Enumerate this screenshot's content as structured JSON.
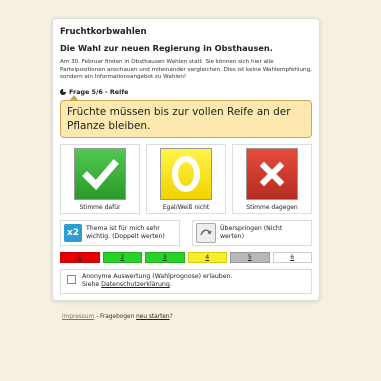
{
  "app_title": "Fruchtkorbwahlen",
  "headline": "Die Wahl zur neuen Regierung in Obsthausen.",
  "intro": "Am 30. Februar finden in Obsthausen Wahlen statt. Sie können sich hier alle Parteipositionen anschauen und miteinander vergleichen. Dies ist keine Wahlempfehlung, sondern ein Informationsangebot zu Wahlen!",
  "question": {
    "label": "Frage 5/6 - Reife",
    "text": "Früchte müssen bis zur vollen Reife an der Pflanze bleiben."
  },
  "answers": [
    {
      "label": "Stimme dafür",
      "icon": "check-icon",
      "color": "#3cb43c"
    },
    {
      "label": "Egal/Weiß nicht",
      "icon": "circle-icon",
      "color": "#f5e51a"
    },
    {
      "label": "Stimme dagegen",
      "icon": "x-icon",
      "color": "#d63a2e"
    }
  ],
  "options": [
    {
      "icon": "x2-icon",
      "badge": "x2",
      "text": "Thema ist für mich sehr wichtig. (Doppelt werten)"
    },
    {
      "icon": "skip-icon",
      "text": "Überspringen (Nicht werten)"
    }
  ],
  "progress": {
    "current": 5,
    "total": 6,
    "steps": [
      {
        "label": "1",
        "color": "#e50000"
      },
      {
        "label": "2",
        "color": "#26d326"
      },
      {
        "label": "3",
        "color": "#26d326"
      },
      {
        "label": "4",
        "color": "#f7ee2a"
      },
      {
        "label": "5",
        "color": "#b8b8b8"
      },
      {
        "label": "6",
        "color": "#ffffff"
      }
    ]
  },
  "consent": {
    "text": "Anonyme Auswertung (Wahlprognose) erlauben.",
    "link_prefix": "Siehe",
    "link": "Datenschutzerklärung",
    "link_suffix": "."
  },
  "footer": {
    "impressum": "Impressum",
    "separator": "- Fragebogen",
    "restart": "neu starten",
    "suffix": "?"
  }
}
